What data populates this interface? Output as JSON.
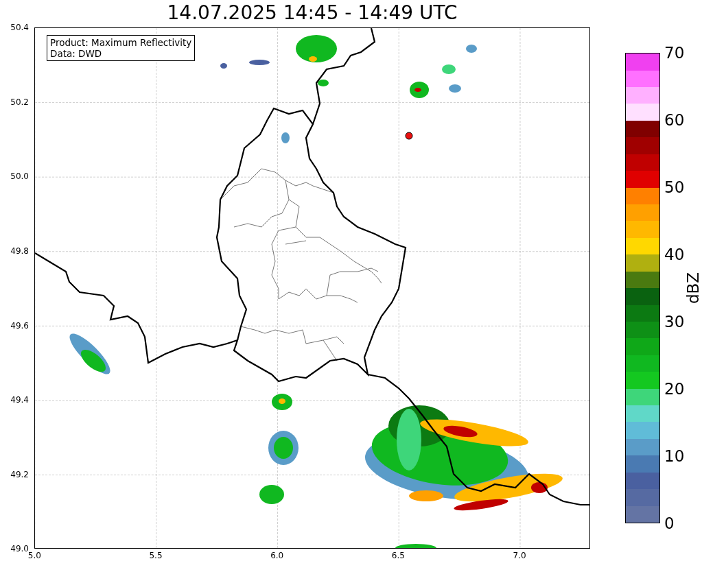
{
  "title": "14.07.2025 14:45 - 14:49 UTC",
  "map": {
    "legend": [
      "Product: Maximum Reflectivity",
      "Data: DWD"
    ],
    "y_ticks": [
      "50.4",
      "50.2",
      "50.0",
      "49.8",
      "49.6",
      "49.4",
      "49.2",
      "49.0"
    ],
    "x_ticks": [
      "5.0",
      "5.5",
      "6.0",
      "6.5",
      "7.0"
    ]
  },
  "colorbar": {
    "label": "dBZ",
    "ticks": [
      "70",
      "60",
      "50",
      "40",
      "30",
      "20",
      "10",
      "0"
    ],
    "segments": [
      {
        "color": "#6474a4"
      },
      {
        "color": "#566aa2"
      },
      {
        "color": "#4a60a0"
      },
      {
        "color": "#4a7ab2"
      },
      {
        "color": "#5a9cc8"
      },
      {
        "color": "#60bcd8"
      },
      {
        "color": "#60d8c8"
      },
      {
        "color": "#3ed67a"
      },
      {
        "color": "#14c820"
      },
      {
        "color": "#10b820"
      },
      {
        "color": "#0fa818"
      },
      {
        "color": "#0e9016"
      },
      {
        "color": "#0c7a12"
      },
      {
        "color": "#0a6210"
      },
      {
        "color": "#4a7a10"
      },
      {
        "color": "#b0b010"
      },
      {
        "color": "#ffd800"
      },
      {
        "color": "#ffb800"
      },
      {
        "color": "#ffa000"
      },
      {
        "color": "#ff8000"
      },
      {
        "color": "#e00000"
      },
      {
        "color": "#c00000"
      },
      {
        "color": "#a00000"
      },
      {
        "color": "#800000"
      },
      {
        "color": "#ffe0ff"
      },
      {
        "color": "#ffb0ff"
      },
      {
        "color": "#ff70ff"
      },
      {
        "color": "#f040f0"
      }
    ]
  }
}
